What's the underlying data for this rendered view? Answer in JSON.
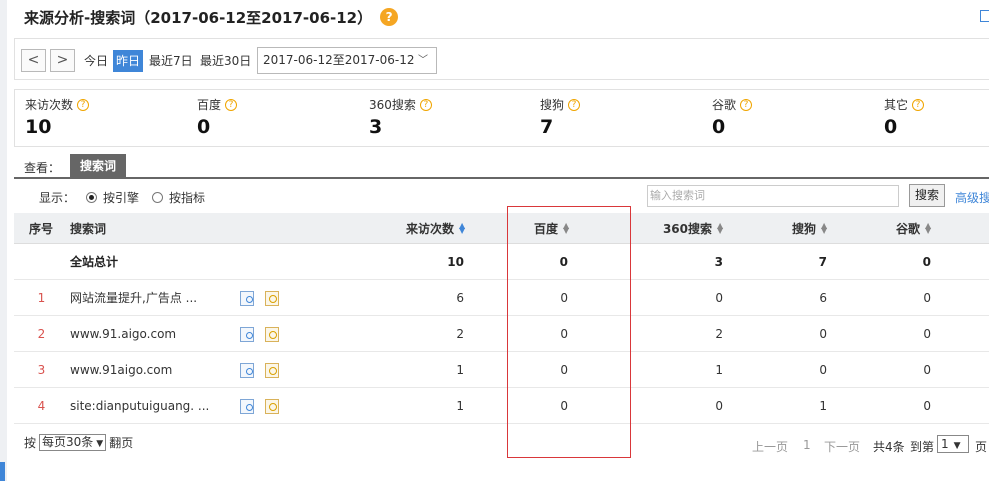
{
  "header": {
    "title": "来源分析-搜索词（2017-06-12至2017-06-12）",
    "help": "?"
  },
  "toolbar": {
    "prev": "<",
    "next": ">",
    "ranges": [
      "今日",
      "昨日",
      "最近7日",
      "最近30日"
    ],
    "active_range": "昨日",
    "date_value": "2017-06-12至2017-06-12"
  },
  "metrics": [
    {
      "label": "来访次数",
      "value": "10"
    },
    {
      "label": "百度",
      "value": "0"
    },
    {
      "label": "360搜索",
      "value": "3"
    },
    {
      "label": "搜狗",
      "value": "7"
    },
    {
      "label": "谷歌",
      "value": "0"
    },
    {
      "label": "其它",
      "value": "0"
    }
  ],
  "view": {
    "label": "查看：",
    "tab": "搜索词"
  },
  "display": {
    "label": "显示：",
    "options": [
      "按引擎",
      "按指标"
    ],
    "selected": "按引擎",
    "search_placeholder": "输入搜索词",
    "search_button": "搜索",
    "advanced_link": "高级搜"
  },
  "table": {
    "headers": [
      "序号",
      "搜索词",
      "来访次数",
      "百度",
      "360搜索",
      "搜狗",
      "谷歌"
    ],
    "total": {
      "label": "全站总计",
      "visits": "10",
      "baidu": "0",
      "s360": "3",
      "sogou": "7",
      "google": "0"
    },
    "rows": [
      {
        "idx": "1",
        "term": "网站流量提升,广告点 ...",
        "visits": "6",
        "baidu": "0",
        "s360": "0",
        "sogou": "6",
        "google": "0"
      },
      {
        "idx": "2",
        "term": "www.91.aigo.com",
        "visits": "2",
        "baidu": "0",
        "s360": "2",
        "sogou": "0",
        "google": "0"
      },
      {
        "idx": "3",
        "term": "www.91aigo.com",
        "visits": "1",
        "baidu": "0",
        "s360": "1",
        "sogou": "0",
        "google": "0"
      },
      {
        "idx": "4",
        "term": "site:dianputuiguang. ...",
        "visits": "1",
        "baidu": "0",
        "s360": "0",
        "sogou": "1",
        "google": "0"
      }
    ]
  },
  "footer": {
    "by": "按",
    "per_page": "每页30条",
    "paging": "翻页",
    "prev": "上一页",
    "page": "1",
    "next": "下一页",
    "total": "共4条",
    "goto": "到第",
    "goto_value": "1",
    "page_unit": "页"
  },
  "colors": {
    "accent": "#3f86d8",
    "highlight_box": "#d9373a",
    "help": "#f5a623"
  }
}
